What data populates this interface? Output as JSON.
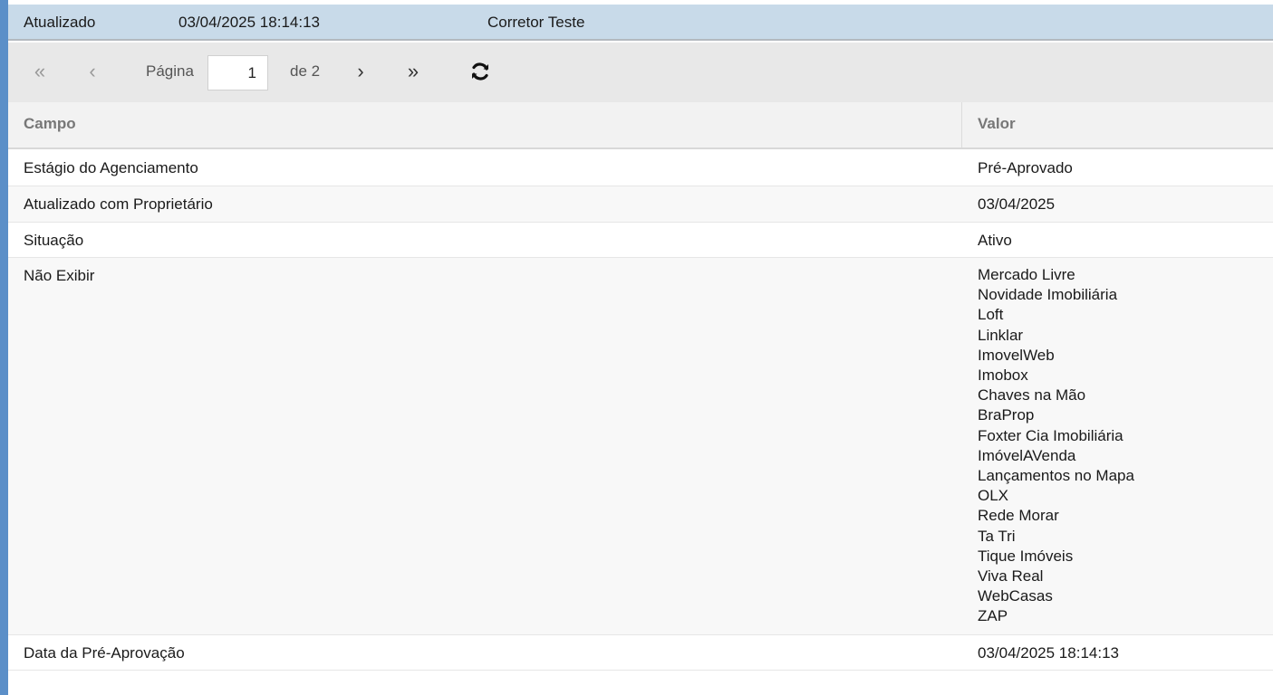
{
  "header": {
    "status": "Atualizado",
    "datetime": "03/04/2025 18:14:13",
    "user": "Corretor Teste"
  },
  "pager": {
    "first_icon": "double-chevron-left-icon",
    "prev_icon": "chevron-left-icon",
    "page_label": "Página",
    "page_value": "1",
    "of_label": "de 2",
    "next_icon": "chevron-right-icon",
    "last_icon": "double-chevron-right-icon",
    "refresh_icon": "refresh-icon"
  },
  "table": {
    "columns": [
      "Campo",
      "Valor"
    ],
    "rows": [
      {
        "campo": "Estágio do Agenciamento",
        "valor": "Pré-Aprovado"
      },
      {
        "campo": "Atualizado com Proprietário",
        "valor": "03/04/2025"
      },
      {
        "campo": "Situação",
        "valor": "Ativo"
      },
      {
        "campo": "Não Exibir",
        "valores": [
          "Mercado Livre",
          "Novidade Imobiliária",
          "Loft",
          "Linklar",
          "ImovelWeb",
          "Imobox",
          "Chaves na Mão",
          "BraProp",
          "Foxter Cia Imobiliária",
          "ImóvelAVenda",
          "Lançamentos no Mapa",
          "OLX",
          "Rede Morar",
          "Ta Tri",
          "Tique Imóveis",
          "Viva Real",
          "WebCasas",
          "ZAP"
        ]
      },
      {
        "campo": "Data da Pré-Aprovação",
        "valor": "03/04/2025 18:14:13"
      }
    ]
  },
  "colors": {
    "accent": "#5b8fc8",
    "header_bg": "#c8dae9",
    "toolbar_bg": "#e8e8e8"
  }
}
